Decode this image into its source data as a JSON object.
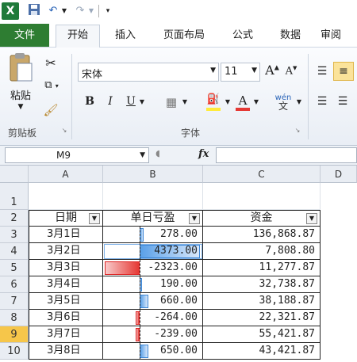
{
  "qat": {
    "app_icon": "X",
    "save_icon": "save-icon",
    "undo_icon": "undo-icon",
    "redo_icon": "redo-icon"
  },
  "tabs": [
    {
      "label": "文件"
    },
    {
      "label": "开始"
    },
    {
      "label": "插入"
    },
    {
      "label": "页面布局"
    },
    {
      "label": "公式"
    },
    {
      "label": "数据"
    },
    {
      "label": "审阅"
    }
  ],
  "ribbon": {
    "clipboard": {
      "paste": "粘贴",
      "group": "剪贴板"
    },
    "font": {
      "name": "宋体",
      "size": "11",
      "grow": "A",
      "shrink": "A",
      "bold": "B",
      "italic": "I",
      "underline": "U",
      "color_letter": "A",
      "phonetic": "wén",
      "group": "字体"
    }
  },
  "formula_bar": {
    "name_box": "M9",
    "fx": "fx",
    "formula": ""
  },
  "columns": [
    "A",
    "B",
    "C",
    "D"
  ],
  "rows": [
    "1",
    "2",
    "3",
    "4",
    "5",
    "6",
    "7",
    "8",
    "9",
    "10"
  ],
  "selected_row": "9",
  "table": {
    "headers": [
      "日期",
      "单日亏盈",
      "资金"
    ],
    "rows": [
      {
        "date": "3月1日",
        "pl": "278.00",
        "fund": "136,868.87"
      },
      {
        "date": "3月2日",
        "pl": "4373.00",
        "fund": "7,808.80"
      },
      {
        "date": "3月3日",
        "pl": "-2323.00",
        "fund": "11,277.87"
      },
      {
        "date": "3月4日",
        "pl": "190.00",
        "fund": "32,738.87"
      },
      {
        "date": "3月5日",
        "pl": "660.00",
        "fund": "38,188.87"
      },
      {
        "date": "3月6日",
        "pl": "-264.00",
        "fund": "22,321.87"
      },
      {
        "date": "3月7日",
        "pl": "-239.00",
        "fund": "55,421.87"
      },
      {
        "date": "3月8日",
        "pl": "650.00",
        "fund": "43,421.87"
      }
    ]
  },
  "data_bar": {
    "values": [
      278,
      4373,
      -2323,
      190,
      660,
      -264,
      -239,
      650
    ],
    "positive_color": "#3d86d6",
    "negative_color": "#e53935"
  },
  "colors": {
    "file_tab": "#2e7d32",
    "selected_row": "#f6c64a",
    "font_color_underline": "#e53935",
    "highlight_underline": "#ffeb3b"
  }
}
